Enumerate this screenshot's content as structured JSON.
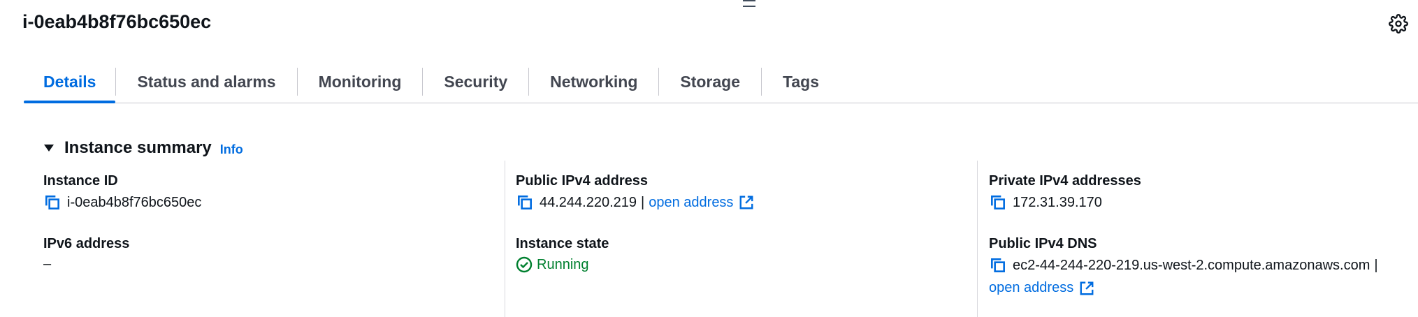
{
  "header": {
    "title": "i-0eab4b8f76bc650ec"
  },
  "tabs": [
    {
      "label": "Details",
      "active": true
    },
    {
      "label": "Status and alarms",
      "active": false
    },
    {
      "label": "Monitoring",
      "active": false
    },
    {
      "label": "Security",
      "active": false
    },
    {
      "label": "Networking",
      "active": false
    },
    {
      "label": "Storage",
      "active": false
    },
    {
      "label": "Tags",
      "active": false
    }
  ],
  "summary": {
    "title": "Instance summary",
    "info_label": "Info",
    "instance_id": {
      "label": "Instance ID",
      "value": "i-0eab4b8f76bc650ec"
    },
    "ipv6": {
      "label": "IPv6 address",
      "value": "–"
    },
    "public_ipv4": {
      "label": "Public IPv4 address",
      "value": "44.244.220.219",
      "separator": "|",
      "link": "open address"
    },
    "instance_state": {
      "label": "Instance state",
      "value": "Running"
    },
    "private_ipv4": {
      "label": "Private IPv4 addresses",
      "value": "172.31.39.170"
    },
    "public_dns": {
      "label": "Public IPv4 DNS",
      "value": "ec2-44-244-220-219.us-west-2.compute.amazonaws.com",
      "separator": "|",
      "link": "open address"
    }
  },
  "colors": {
    "accent": "#006ce0",
    "success": "#00802f",
    "text": "#0f141a"
  },
  "icons": {
    "settings": "gear-icon",
    "copy": "copy-icon",
    "external": "external-link-icon",
    "status": "check-circle-icon",
    "caret": "caret-down-icon"
  }
}
